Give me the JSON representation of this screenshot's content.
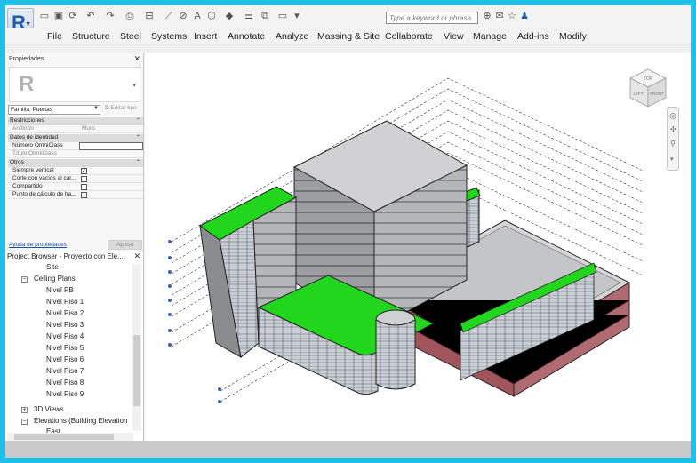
{
  "app": {
    "logo_letter": "R"
  },
  "search": {
    "placeholder": "Type a keyword or phrase"
  },
  "ribbon_tabs": [
    "File",
    "Structure",
    "Steel",
    "Systems",
    "Insert",
    "Annotate",
    "Analyze",
    "Massing & Site",
    "Collaborate",
    "View",
    "Manage",
    "Add-ins",
    "Modify"
  ],
  "properties": {
    "title": "Propiedades",
    "family_select": "Familia: Puertas",
    "edit_type": "Editar tipo",
    "sections": {
      "constraints": "Restricciones",
      "identity": "Datos de identidad",
      "other": "Otros"
    },
    "rows": {
      "host_label": "Anfitrión",
      "host_value": "Muro",
      "omniclass_number": "Número OmniClass",
      "omniclass_title": "Título OmniClass",
      "always_vertical": "Siempre vertical",
      "cut_voids": "Corte con vacíos al car...",
      "shared": "Compartido",
      "room_calc": "Punto de cálculo de ha..."
    },
    "help_link": "Ayuda de propiedades",
    "apply": "Aplicar"
  },
  "browser": {
    "title": "Project Browser - Proyecto con Ele...",
    "nodes": {
      "site": "Site",
      "ceiling_plans": "Ceiling Plans",
      "levels": [
        "Nivel PB",
        "Nivel Piso 1",
        "Nivel Piso 2",
        "Nivel Piso 3",
        "Nivel Piso 4",
        "Nivel Piso 5",
        "Nivel Piso 6",
        "Nivel Piso 7",
        "Nivel Piso 8",
        "Nivel Piso 9"
      ],
      "views_3d": "3D Views",
      "elevations": "Elevations (Building Elevation",
      "east": "East"
    }
  },
  "viewcube": {
    "top": "TOP",
    "left": "LEFT",
    "front": "FRONT"
  },
  "colors": {
    "roof_green": "#22d61e",
    "accent_blue": "#1d5fa8",
    "brick": "#a0555d"
  }
}
